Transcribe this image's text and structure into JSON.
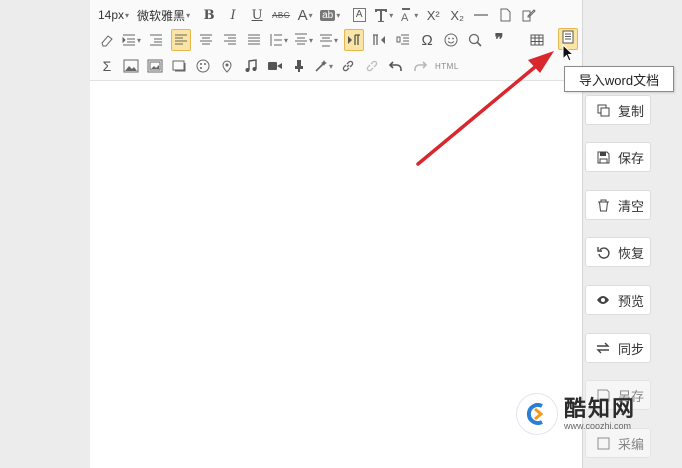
{
  "toolbar": {
    "font_size": "14px",
    "font_family": "微软雅黑",
    "bold": "B",
    "italic": "I",
    "underline": "U",
    "strikethrough": "ABC",
    "font_color": "A",
    "bg_color": "ab",
    "text_box": "A",
    "superscript": "X²",
    "subscript": "X₂",
    "omega": "Ω",
    "quote": "❞",
    "sigma": "Σ",
    "html": "HTML"
  },
  "tooltip": {
    "text": "导入word文档"
  },
  "side_buttons": {
    "copy": "复制",
    "save": "保存",
    "clear": "清空",
    "restore": "恢复",
    "preview": "预览",
    "sync": "同步",
    "partial_1": "另存",
    "partial_2": "采编"
  },
  "watermark": {
    "title": "酷知网",
    "url": "www.coozhi.com"
  },
  "colors": {
    "arrow": "#d8272d",
    "highlight": "#fbe5a4",
    "highlight_border": "#e5b84d"
  }
}
